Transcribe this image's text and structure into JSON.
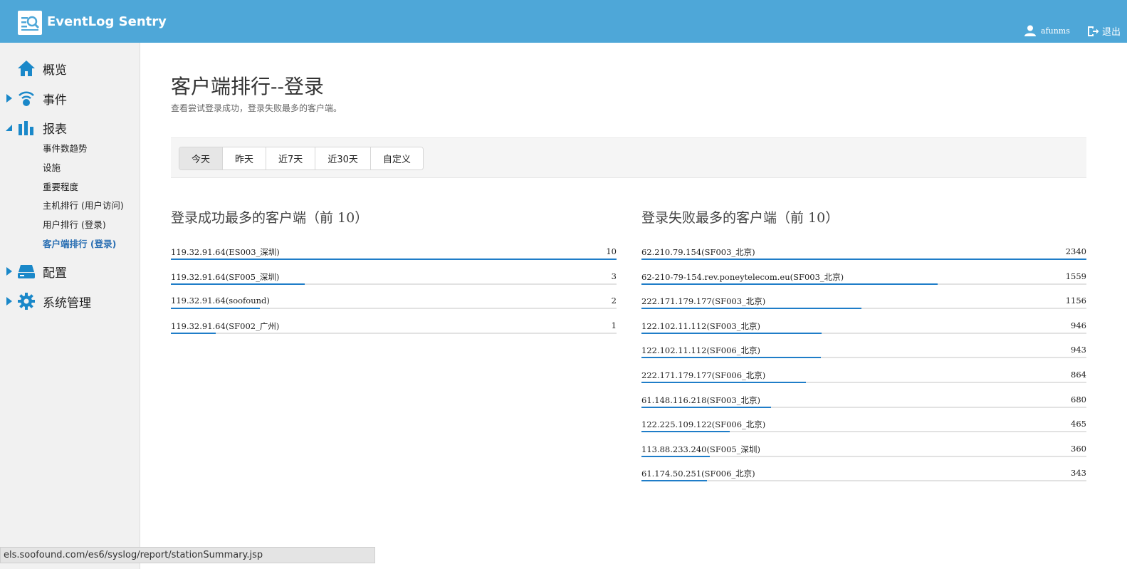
{
  "header": {
    "app_title": "EventLog Sentry",
    "username": "afunms",
    "logout_label": "退出",
    "accent_color": "#4ea7d8"
  },
  "sidebar": {
    "items": [
      {
        "label": "概览",
        "icon": "home-icon"
      },
      {
        "label": "事件",
        "icon": "signal-icon"
      },
      {
        "label": "报表",
        "icon": "bar-chart-icon"
      },
      {
        "label": "配置",
        "icon": "device-icon"
      },
      {
        "label": "系统管理",
        "icon": "gear-icon"
      }
    ],
    "report_subitems": [
      {
        "label": "事件数趋势"
      },
      {
        "label": "设施"
      },
      {
        "label": "重要程度"
      },
      {
        "label": "主机排行 (用户访问)"
      },
      {
        "label": "用户排行 (登录)"
      },
      {
        "label": "客户端排行 (登录)"
      }
    ]
  },
  "main": {
    "title": "客户端排行--登录",
    "subtitle": "查看尝试登录成功，登录失败最多的客户端。",
    "tabs": [
      {
        "label": "今天"
      },
      {
        "label": "昨天"
      },
      {
        "label": "近7天"
      },
      {
        "label": "近30天"
      },
      {
        "label": "自定义"
      }
    ],
    "active_tab": "今天"
  },
  "success_section": {
    "title": "登录成功最多的客户端（前 10）",
    "max": 10,
    "rows": [
      {
        "name": "119.32.91.64(ES003_深圳)",
        "value": 10
      },
      {
        "name": "119.32.91.64(SF005_深圳)",
        "value": 3
      },
      {
        "name": "119.32.91.64(soofound)",
        "value": 2
      },
      {
        "name": "119.32.91.64(SF002_广州)",
        "value": 1
      }
    ]
  },
  "fail_section": {
    "title": "登录失败最多的客户端（前 10）",
    "max": 2340,
    "rows": [
      {
        "name": "62.210.79.154(SF003_北京)",
        "value": 2340
      },
      {
        "name": "62-210-79-154.rev.poneytelecom.eu(SF003_北京)",
        "value": 1559
      },
      {
        "name": "222.171.179.177(SF003_北京)",
        "value": 1156
      },
      {
        "name": "122.102.11.112(SF003_北京)",
        "value": 946
      },
      {
        "name": "122.102.11.112(SF006_北京)",
        "value": 943
      },
      {
        "name": "222.171.179.177(SF006_北京)",
        "value": 864
      },
      {
        "name": "61.148.116.218(SF003_北京)",
        "value": 680
      },
      {
        "name": "122.225.109.122(SF006_北京)",
        "value": 465
      },
      {
        "name": "113.88.233.240(SF005_深圳)",
        "value": 360
      },
      {
        "name": "61.174.50.251(SF006_北京)",
        "value": 343
      }
    ]
  },
  "statusbar": {
    "url": "els.soofound.com/es6/syslog/report/stationSummary.jsp"
  }
}
